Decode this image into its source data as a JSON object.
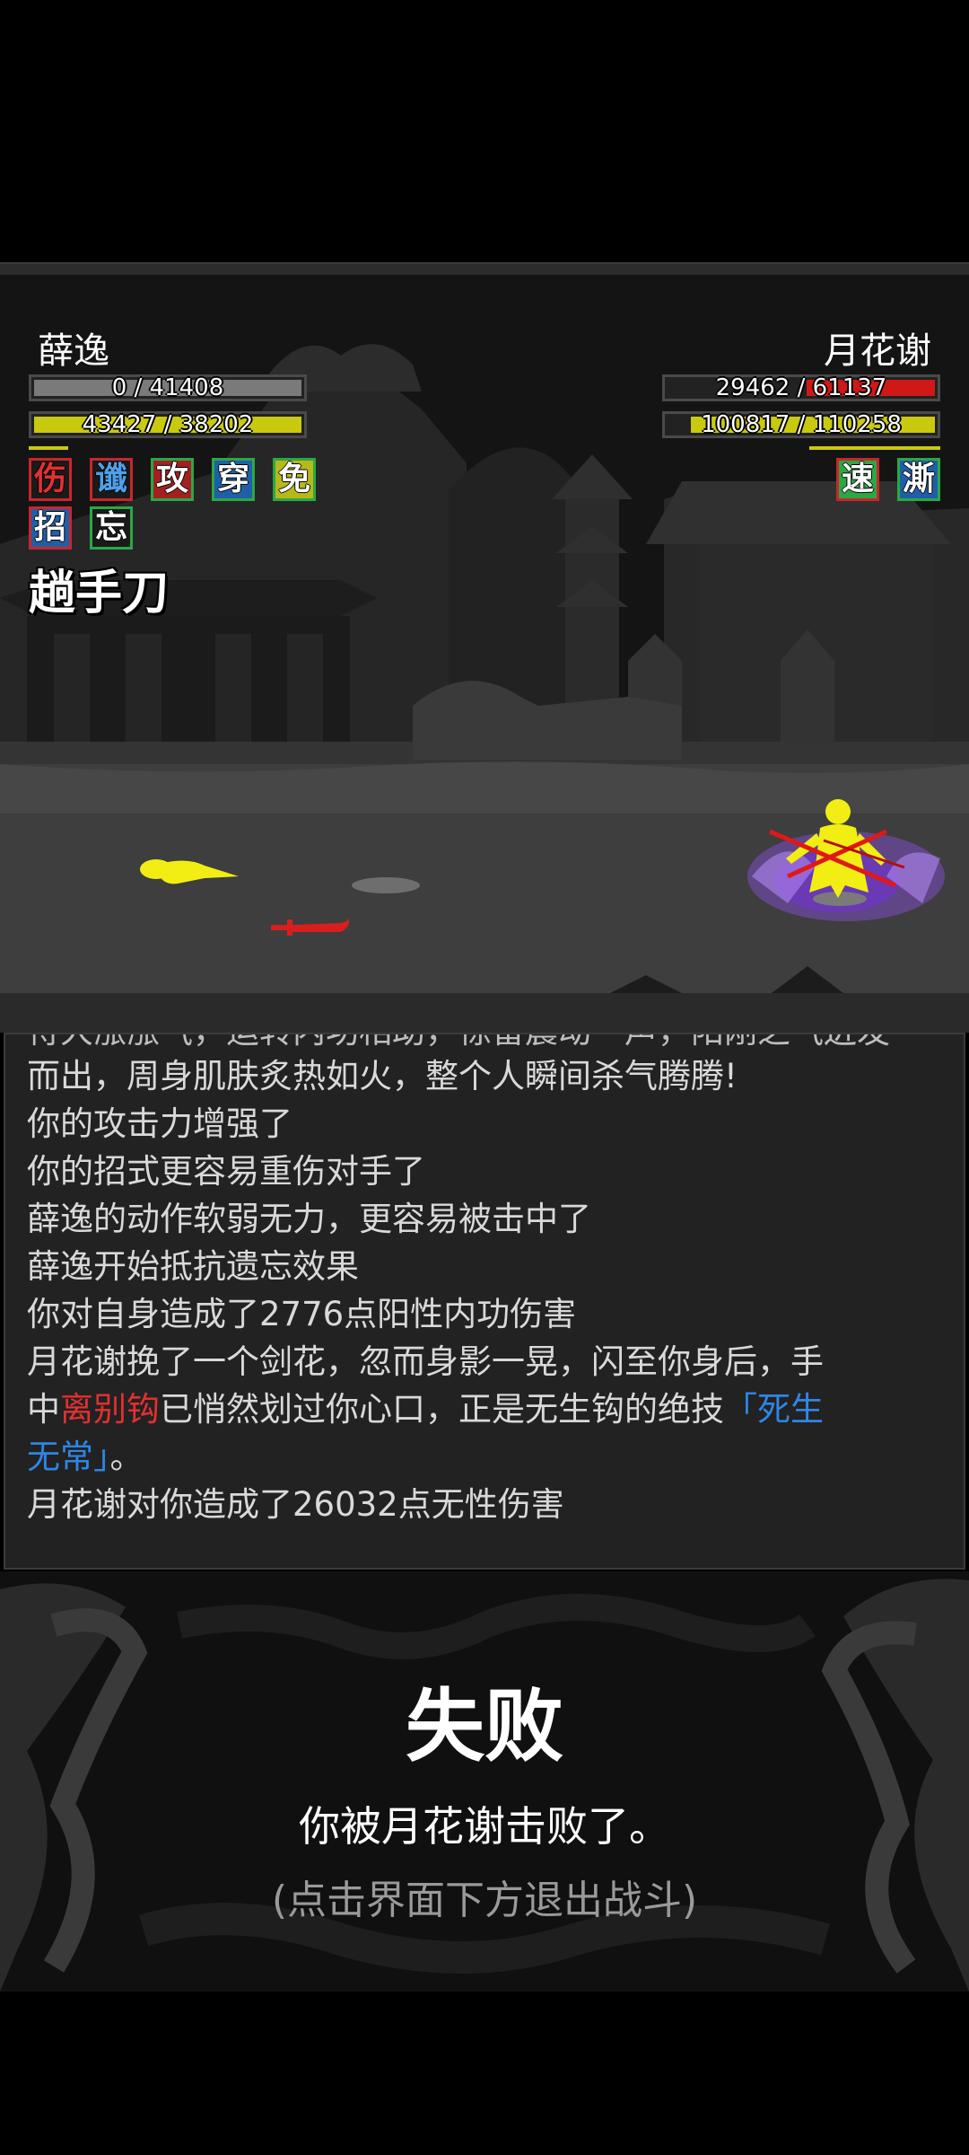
{
  "player": {
    "name": "薛逸",
    "hp_text": "0 / 41408",
    "hp_fraction": 0.0,
    "mp_text": "43427 / 38202",
    "mp_fraction": 1.0,
    "status_tags": [
      {
        "char": "伤",
        "text_color": "#e23030",
        "border_color": "#c8262c",
        "bg": "#1a1a1a"
      },
      {
        "char": "谶",
        "text_color": "#4ea0e8",
        "border_color": "#c8262c",
        "bg": "#1a1a1a"
      },
      {
        "char": "攻",
        "text_color": "#ffffff",
        "border_color": "#2aa844",
        "bg": "#a32020"
      },
      {
        "char": "穿",
        "text_color": "#ffffff",
        "border_color": "#2aa844",
        "bg": "#1f5fa8"
      },
      {
        "char": "免",
        "text_color": "#ffffff",
        "border_color": "#2aa844",
        "bg": "#b8b81a"
      },
      {
        "char": "招",
        "text_color": "#ffffff",
        "border_color": "#c8262c",
        "bg": "#1f5fa8"
      },
      {
        "char": "忘",
        "text_color": "#ffffff",
        "border_color": "#2aa844",
        "bg": "#1a1a1a"
      }
    ],
    "current_skill": "趟手刀"
  },
  "enemy": {
    "name": "月花谢",
    "hp_text": "29462 / 61137",
    "hp_fraction": 0.48,
    "mp_text": "100817 / 110258",
    "mp_fraction": 0.914,
    "status_tags": [
      {
        "char": "速",
        "text_color": "#ffffff",
        "border_color": "#c8262c",
        "bg": "#2aa844"
      },
      {
        "char": "澌",
        "text_color": "#ffffff",
        "border_color": "#2aa844",
        "bg": "#1f5fa8"
      }
    ]
  },
  "colors": {
    "hp_red": "#d01818",
    "mp_yellow": "#c9c910",
    "fighter_yellow": "#f2ee14",
    "aura_purple": "#8a4fe0"
  },
  "log": {
    "partial_top": "待大涨涨气，运转内功相助，惊雷震动一声，阳刚之气迸发",
    "lines": [
      "而出，周身肌肤炙热如火，整个人瞬间杀气腾腾!",
      "你的攻击力增强了",
      "你的招式更容易重伤对手了",
      "薛逸的动作软弱无力，更容易被击中了",
      "薛逸开始抵抗遗忘效果",
      "你对自身造成了2776点阳性内功伤害",
      "月花谢挽了一个剑花，忽而身影一晃，闪至你身后，手"
    ],
    "rich_line1": {
      "pre": "中",
      "weapon": "离别钩",
      "mid": "已悄然划过你心口，正是无生钩的绝技",
      "skill_a": "「死生"
    },
    "rich_line2": {
      "skill_b": "无常」",
      "post": "。"
    },
    "last_line": "月花谢对你造成了26032点无性伤害"
  },
  "result": {
    "title": "失败",
    "message": "你被月花谢击败了。",
    "hint": "(点击界面下方退出战斗)"
  }
}
